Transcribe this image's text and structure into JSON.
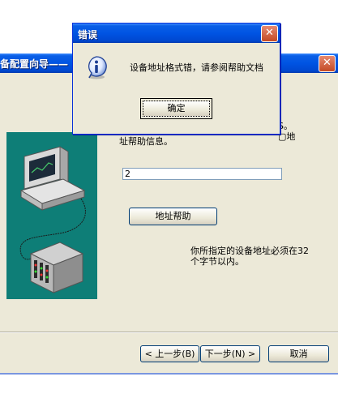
{
  "wizard": {
    "title": "备配置向导——",
    "close_glyph": "✕",
    "text_fragment": "S。\n▢地",
    "intro_text": "址帮助信息。",
    "address_input_value": "2",
    "help_button_label": "地址帮助",
    "note": "你所指定的设备地址必须在32个字节以内。",
    "prev_button_label": "< 上一步(B)",
    "next_button_label": "下一步(N) >",
    "cancel_button_label": "取消"
  },
  "error_dialog": {
    "title": "错误",
    "close_glyph": "✕",
    "icon": "info-icon",
    "message": "设备地址格式错，请参阅帮助文档",
    "ok_button_label": "确定"
  },
  "colors": {
    "titlebar": "#0054e3",
    "dialog_bg": "#ece9d8",
    "illustration_bg": "#0e7e77",
    "close_button": "#c44a25"
  }
}
